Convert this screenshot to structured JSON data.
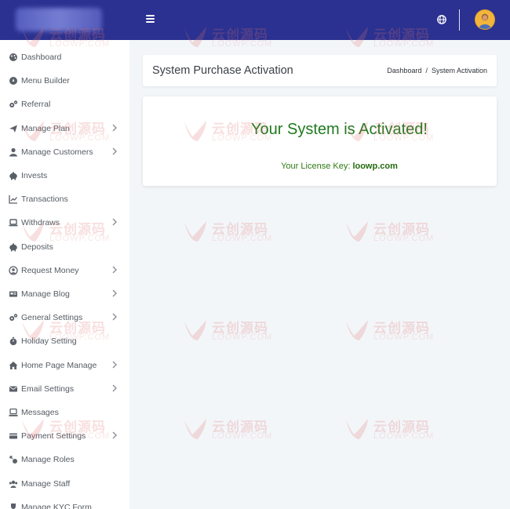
{
  "header": {
    "menu_icon": "hamburger-icon",
    "language_icon": "globe-icon",
    "avatar_icon": "user-avatar"
  },
  "sidebar": {
    "items": [
      {
        "label": "Dashboard",
        "icon": "palette-icon",
        "has_submenu": false
      },
      {
        "label": "Menu Builder",
        "icon": "compass-icon",
        "has_submenu": false
      },
      {
        "label": "Referral",
        "icon": "cogs-icon",
        "has_submenu": false
      },
      {
        "label": "Manage Plan",
        "icon": "send-icon",
        "has_submenu": true
      },
      {
        "label": "Manage Customers",
        "icon": "user-icon",
        "has_submenu": true
      },
      {
        "label": "Invests",
        "icon": "piggy-bank-icon",
        "has_submenu": false
      },
      {
        "label": "Transactions",
        "icon": "chart-line-icon",
        "has_submenu": false
      },
      {
        "label": "Withdraws",
        "icon": "laptop-icon",
        "has_submenu": true
      },
      {
        "label": "Deposits",
        "icon": "piggy-bank-icon",
        "has_submenu": false
      },
      {
        "label": "Request Money",
        "icon": "user-circle-icon",
        "has_submenu": true
      },
      {
        "label": "Manage Blog",
        "icon": "newspaper-icon",
        "has_submenu": true
      },
      {
        "label": "General Settings",
        "icon": "cogs-icon",
        "has_submenu": true
      },
      {
        "label": "Holiday Setting",
        "icon": "stopwatch-icon",
        "has_submenu": false
      },
      {
        "label": "Home Page Manage",
        "icon": "home-icon",
        "has_submenu": true
      },
      {
        "label": "Email Settings",
        "icon": "envelope-icon",
        "has_submenu": true
      },
      {
        "label": "Messages",
        "icon": "messages-icon",
        "has_submenu": false
      },
      {
        "label": "Payment Settings",
        "icon": "credit-card-icon",
        "has_submenu": true
      },
      {
        "label": "Manage Roles",
        "icon": "key-icon",
        "has_submenu": false
      },
      {
        "label": "Manage Staff",
        "icon": "users-icon",
        "has_submenu": false
      },
      {
        "label": "Manage KYC Form",
        "icon": "trophy-icon",
        "has_submenu": false
      }
    ]
  },
  "main": {
    "page_title": "System Purchase Activation",
    "breadcrumb": {
      "home": "Dashboard",
      "separator": "/",
      "current": "System Activation"
    },
    "activation": {
      "message": "Your System is Activated!",
      "license_label": "Your License Key:",
      "license_value": "loowp.com"
    }
  },
  "watermark": {
    "cn": "云创源码",
    "en": "LOOWP.COM"
  },
  "colors": {
    "header_bg": "#2a3190",
    "success_text": "#1f7a1f",
    "sidebar_bg": "#ffffff",
    "page_bg": "#f3f6f9"
  }
}
